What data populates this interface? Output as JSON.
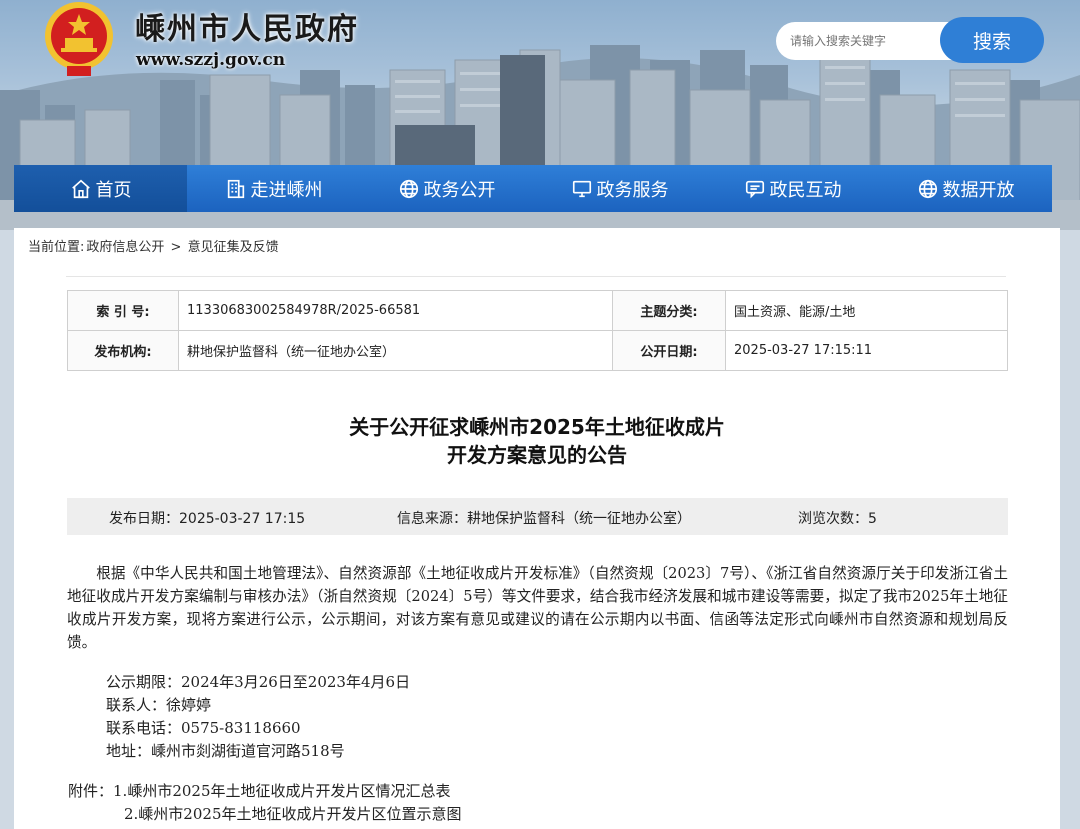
{
  "header": {
    "site_title": "嵊州市人民政府",
    "site_url": "www.szzj.gov.cn",
    "search_placeholder": "请输入搜索关键字",
    "search_button": "搜索"
  },
  "nav": {
    "items": [
      {
        "label": "首页",
        "icon": "home-icon"
      },
      {
        "label": "走进嵊州",
        "icon": "building-icon"
      },
      {
        "label": "政务公开",
        "icon": "globe-icon"
      },
      {
        "label": "政务服务",
        "icon": "monitor-icon"
      },
      {
        "label": "政民互动",
        "icon": "chat-icon"
      },
      {
        "label": "数据开放",
        "icon": "globe-icon"
      }
    ]
  },
  "breadcrumb": {
    "prefix": "当前位置:",
    "items": [
      "政府信息公开",
      "意见征集及反馈"
    ],
    "separator": ">"
  },
  "meta": {
    "index_label": "索 引 号:",
    "index_value": "11330683002584978R/2025-66581",
    "topic_label": "主题分类:",
    "topic_value": "国土资源、能源/土地",
    "org_label": "发布机构:",
    "org_value": "耕地保护监督科（统一征地办公室）",
    "date_label": "公开日期:",
    "date_value": "2025-03-27 17:15:11"
  },
  "article": {
    "title_line1": "关于公开征求嵊州市2025年土地征收成片",
    "title_line2": "开发方案意见的公告",
    "publish_date": "发布日期：2025-03-27 17:15",
    "source": "信息来源：耕地保护监督科（统一征地办公室）",
    "views": "浏览次数：5",
    "paragraph": "根据《中华人民共和国土地管理法》、自然资源部《土地征收成片开发标准》（自然资规〔2023〕7号）、《浙江省自然资源厅关于印发浙江省土地征收成片开发方案编制与审核办法》（浙自然资规〔2024〕5号）等文件要求，结合我市经济发展和城市建设等需要，拟定了我市2025年土地征收成片开发方案，现将方案进行公示，公示期间，对该方案有意见或建议的请在公示期内以书面、信函等法定形式向嵊州市自然资源和规划局反馈。",
    "period": "公示期限：2024年3月26日至2023年4月6日",
    "contact_person": "联系人：徐婷婷",
    "phone": "联系电话：0575-83118660",
    "address": "地址：嵊州市剡湖街道官河路518号",
    "attach_label": "附件：",
    "attach1": "1.嵊州市2025年土地征收成片开发片区情况汇总表",
    "attach2": "2.嵊州市2025年土地征收成片开发片区位置示意图"
  },
  "colors": {
    "nav_blue": "#2f7fd8",
    "nav_active": "#134f9a",
    "search_button": "#2f7fd6",
    "emblem_red": "#d21f1f",
    "emblem_gold": "#f2c230"
  }
}
